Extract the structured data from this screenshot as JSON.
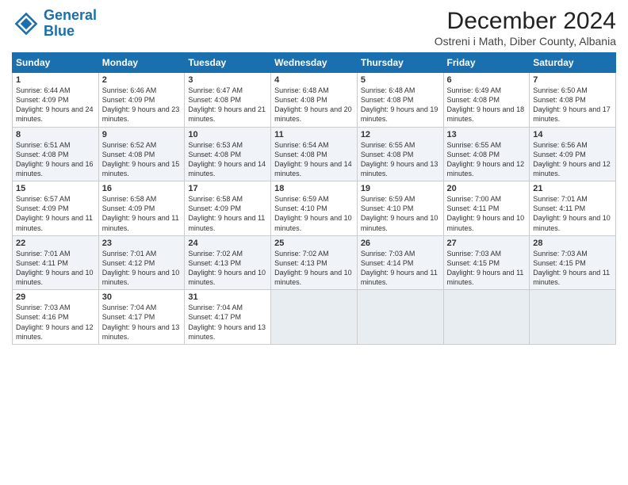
{
  "logo": {
    "line1": "General",
    "line2": "Blue"
  },
  "title": "December 2024",
  "subtitle": "Ostreni i Math, Diber County, Albania",
  "days": [
    "Sunday",
    "Monday",
    "Tuesday",
    "Wednesday",
    "Thursday",
    "Friday",
    "Saturday"
  ],
  "weeks": [
    [
      {
        "day": "1",
        "sunrise": "6:44 AM",
        "sunset": "4:09 PM",
        "daylight": "9 hours and 24 minutes."
      },
      {
        "day": "2",
        "sunrise": "6:46 AM",
        "sunset": "4:09 PM",
        "daylight": "9 hours and 23 minutes."
      },
      {
        "day": "3",
        "sunrise": "6:47 AM",
        "sunset": "4:08 PM",
        "daylight": "9 hours and 21 minutes."
      },
      {
        "day": "4",
        "sunrise": "6:48 AM",
        "sunset": "4:08 PM",
        "daylight": "9 hours and 20 minutes."
      },
      {
        "day": "5",
        "sunrise": "6:48 AM",
        "sunset": "4:08 PM",
        "daylight": "9 hours and 19 minutes."
      },
      {
        "day": "6",
        "sunrise": "6:49 AM",
        "sunset": "4:08 PM",
        "daylight": "9 hours and 18 minutes."
      },
      {
        "day": "7",
        "sunrise": "6:50 AM",
        "sunset": "4:08 PM",
        "daylight": "9 hours and 17 minutes."
      }
    ],
    [
      {
        "day": "8",
        "sunrise": "6:51 AM",
        "sunset": "4:08 PM",
        "daylight": "9 hours and 16 minutes."
      },
      {
        "day": "9",
        "sunrise": "6:52 AM",
        "sunset": "4:08 PM",
        "daylight": "9 hours and 15 minutes."
      },
      {
        "day": "10",
        "sunrise": "6:53 AM",
        "sunset": "4:08 PM",
        "daylight": "9 hours and 14 minutes."
      },
      {
        "day": "11",
        "sunrise": "6:54 AM",
        "sunset": "4:08 PM",
        "daylight": "9 hours and 14 minutes."
      },
      {
        "day": "12",
        "sunrise": "6:55 AM",
        "sunset": "4:08 PM",
        "daylight": "9 hours and 13 minutes."
      },
      {
        "day": "13",
        "sunrise": "6:55 AM",
        "sunset": "4:08 PM",
        "daylight": "9 hours and 12 minutes."
      },
      {
        "day": "14",
        "sunrise": "6:56 AM",
        "sunset": "4:09 PM",
        "daylight": "9 hours and 12 minutes."
      }
    ],
    [
      {
        "day": "15",
        "sunrise": "6:57 AM",
        "sunset": "4:09 PM",
        "daylight": "9 hours and 11 minutes."
      },
      {
        "day": "16",
        "sunrise": "6:58 AM",
        "sunset": "4:09 PM",
        "daylight": "9 hours and 11 minutes."
      },
      {
        "day": "17",
        "sunrise": "6:58 AM",
        "sunset": "4:09 PM",
        "daylight": "9 hours and 11 minutes."
      },
      {
        "day": "18",
        "sunrise": "6:59 AM",
        "sunset": "4:10 PM",
        "daylight": "9 hours and 10 minutes."
      },
      {
        "day": "19",
        "sunrise": "6:59 AM",
        "sunset": "4:10 PM",
        "daylight": "9 hours and 10 minutes."
      },
      {
        "day": "20",
        "sunrise": "7:00 AM",
        "sunset": "4:11 PM",
        "daylight": "9 hours and 10 minutes."
      },
      {
        "day": "21",
        "sunrise": "7:01 AM",
        "sunset": "4:11 PM",
        "daylight": "9 hours and 10 minutes."
      }
    ],
    [
      {
        "day": "22",
        "sunrise": "7:01 AM",
        "sunset": "4:11 PM",
        "daylight": "9 hours and 10 minutes."
      },
      {
        "day": "23",
        "sunrise": "7:01 AM",
        "sunset": "4:12 PM",
        "daylight": "9 hours and 10 minutes."
      },
      {
        "day": "24",
        "sunrise": "7:02 AM",
        "sunset": "4:13 PM",
        "daylight": "9 hours and 10 minutes."
      },
      {
        "day": "25",
        "sunrise": "7:02 AM",
        "sunset": "4:13 PM",
        "daylight": "9 hours and 10 minutes."
      },
      {
        "day": "26",
        "sunrise": "7:03 AM",
        "sunset": "4:14 PM",
        "daylight": "9 hours and 11 minutes."
      },
      {
        "day": "27",
        "sunrise": "7:03 AM",
        "sunset": "4:15 PM",
        "daylight": "9 hours and 11 minutes."
      },
      {
        "day": "28",
        "sunrise": "7:03 AM",
        "sunset": "4:15 PM",
        "daylight": "9 hours and 11 minutes."
      }
    ],
    [
      {
        "day": "29",
        "sunrise": "7:03 AM",
        "sunset": "4:16 PM",
        "daylight": "9 hours and 12 minutes."
      },
      {
        "day": "30",
        "sunrise": "7:04 AM",
        "sunset": "4:17 PM",
        "daylight": "9 hours and 13 minutes."
      },
      {
        "day": "31",
        "sunrise": "7:04 AM",
        "sunset": "4:17 PM",
        "daylight": "9 hours and 13 minutes."
      },
      null,
      null,
      null,
      null
    ]
  ]
}
